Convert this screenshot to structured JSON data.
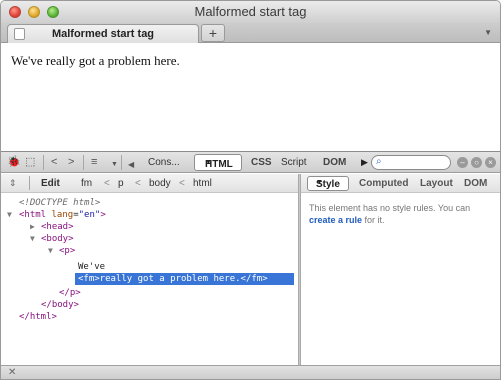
{
  "window": {
    "title": "Malformed start tag"
  },
  "tabs": [
    {
      "label": "Malformed start tag"
    }
  ],
  "new_tab_label": "+",
  "page": {
    "text": "We've really got a problem here."
  },
  "inspector": {
    "tabs": [
      "Cons...",
      "HTML",
      "CSS",
      "Script",
      "DOM"
    ],
    "active_tab": "HTML",
    "active_tab_arrow": "▼",
    "breadcrumb": {
      "edit": "Edit",
      "items": [
        "fm",
        "p",
        "body",
        "html"
      ],
      "sep": "<"
    },
    "tree": {
      "doctype": "<!DOCTYPE html>",
      "html_open_tag": "<html",
      "html_attr_name": "lang",
      "html_attr_value": "\"en\"",
      "html_open_close": ">",
      "head": "<head>",
      "body_open": "<body>",
      "p_open": "<p>",
      "text_node": "We've",
      "selected": "<fm>really got a problem here.</fm>",
      "p_close": "</p>",
      "body_close": "</body>",
      "html_close": "</html>"
    }
  },
  "style_panel": {
    "tabs": [
      "Style",
      "Computed",
      "Layout",
      "DOM"
    ],
    "active_tab": "Style",
    "message_before": "This element has no style rules. You can ",
    "link": "create a rule",
    "message_after": " for it."
  },
  "statusbar": {
    "close_symbol": "✕"
  }
}
